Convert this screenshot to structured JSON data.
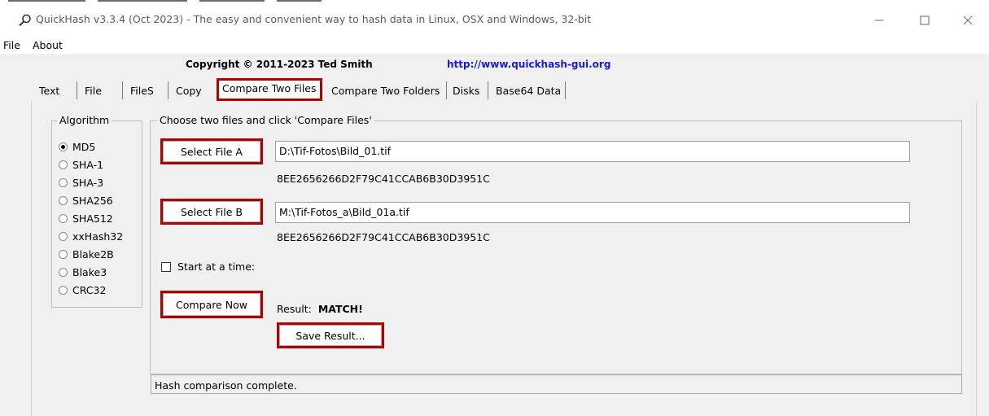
{
  "window": {
    "title": "QuickHash v3.3.4 (Oct 2023) - The easy and convenient way to hash data in Linux, OSX and Windows, 32-bit",
    "app_icon": "magnifier-icon",
    "controls": {
      "minimize": "minimize-icon",
      "maximize": "maximize-icon",
      "close": "close-icon"
    }
  },
  "menu": {
    "file": "File",
    "about": "About"
  },
  "header": {
    "copyright": "Copyright © 2011-2023  Ted Smith",
    "homepage": "http://www.quickhash-gui.org"
  },
  "tabs": [
    {
      "label": "Text"
    },
    {
      "label": "File"
    },
    {
      "label": "FileS"
    },
    {
      "label": "Copy"
    },
    {
      "label": "Compare Two Files",
      "active": true
    },
    {
      "label": "Compare Two Folders"
    },
    {
      "label": "Disks"
    },
    {
      "label": "Base64 Data"
    }
  ],
  "algorithm": {
    "legend": "Algorithm",
    "options": [
      "MD5",
      "SHA-1",
      "SHA-3",
      "SHA256",
      "SHA512",
      "xxHash32",
      "Blake2B",
      "Blake3",
      "CRC32"
    ],
    "selected": "MD5"
  },
  "compare": {
    "legend": "Choose two files and click 'Compare Files'",
    "select_a_label": "Select File A",
    "file_a_path": "D:\\Tif-Fotos\\Bild_01.tif",
    "file_a_hash": "8EE2656266D2F79C41CCAB6B30D3951C",
    "select_b_label": "Select File B",
    "file_b_path": "M:\\Tif-Fotos_a\\Bild_01a.tif",
    "file_b_hash": "8EE2656266D2F79C41CCAB6B30D3951C",
    "start_at_time_label": "Start at a time:",
    "compare_now_label": "Compare Now",
    "result_label": "Result:",
    "result_value": "MATCH!",
    "save_result_label": "Save Result..."
  },
  "status": {
    "text": "Hash comparison complete."
  },
  "colors": {
    "highlight": "#b00000",
    "link": "#1a1adc"
  }
}
